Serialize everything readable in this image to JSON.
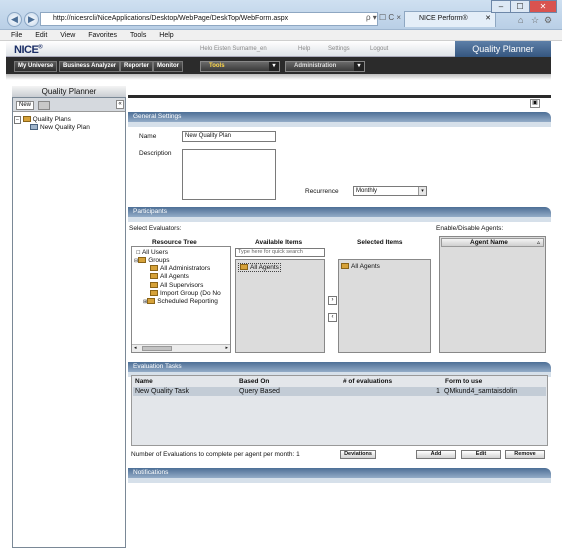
{
  "browser": {
    "url": "http://nicesrcli/NiceApplications/Desktop/WebPage/DeskTop/WebForm.aspx",
    "tab_title": "NICE Perform®",
    "addr_icons": "ρ ▾ ☐ C ×",
    "window_controls": {
      "min": "–",
      "max": "☐",
      "close": "✕"
    },
    "right_icons": [
      "⌂",
      "☆",
      "⚙"
    ]
  },
  "menu": {
    "items": [
      "File",
      "Edit",
      "View",
      "Favorites",
      "Tools",
      "Help"
    ]
  },
  "app": {
    "logo": "NICE",
    "logo_mark": "®",
    "user": "Helo Eisten Surname_en",
    "links": [
      "Help",
      "Settings",
      "Logout"
    ],
    "banner": "Quality Planner"
  },
  "nav": {
    "buttons": [
      "My Universe",
      "Business Analyzer",
      "Reporter",
      "Monitor"
    ],
    "tools": "Tools",
    "admin": "Administration"
  },
  "left": {
    "title": "Quality Planner",
    "new_button": "New",
    "tree_root": "Quality Plans",
    "tree_child": "New Quality Plan"
  },
  "general": {
    "header": "General Settings",
    "name_label": "Name",
    "name_value": "New Quality Plan",
    "description_label": "Description",
    "recurrence_label": "Recurrence",
    "recurrence_value": "Monthly"
  },
  "participants": {
    "header": "Participants",
    "select_evaluators": "Select Evaluators:",
    "resource_tree": "Resource Tree",
    "available_items": "Available Items",
    "selected_items": "Selected Items",
    "enable_disable": "Enable/Disable Agents:",
    "agent_name_col": "Agent Name",
    "search_placeholder": "Type here for quick search",
    "tree_items": [
      "All Users",
      "Groups",
      "All Administrators",
      "All Agents",
      "All Supervisors",
      "Import Group (Do No",
      "Scheduled Reporting"
    ],
    "available_value": "All Agents",
    "selected_value": "All Agents"
  },
  "eval": {
    "header": "Evaluation Tasks",
    "columns": [
      "Name",
      "Based On",
      "# of evaluations",
      "Form to use"
    ],
    "rows": [
      [
        "New Quality Task",
        "Query Based",
        "1",
        "QMkund4_samtaisdolin"
      ]
    ],
    "per_agent_text": "Number of Evaluations to complete per agent per month: 1",
    "btn_deviations": "Deviations",
    "btn_add": "Add",
    "btn_edit": "Edit",
    "btn_remove": "Remove"
  },
  "notifications": {
    "header": "Notifications"
  }
}
